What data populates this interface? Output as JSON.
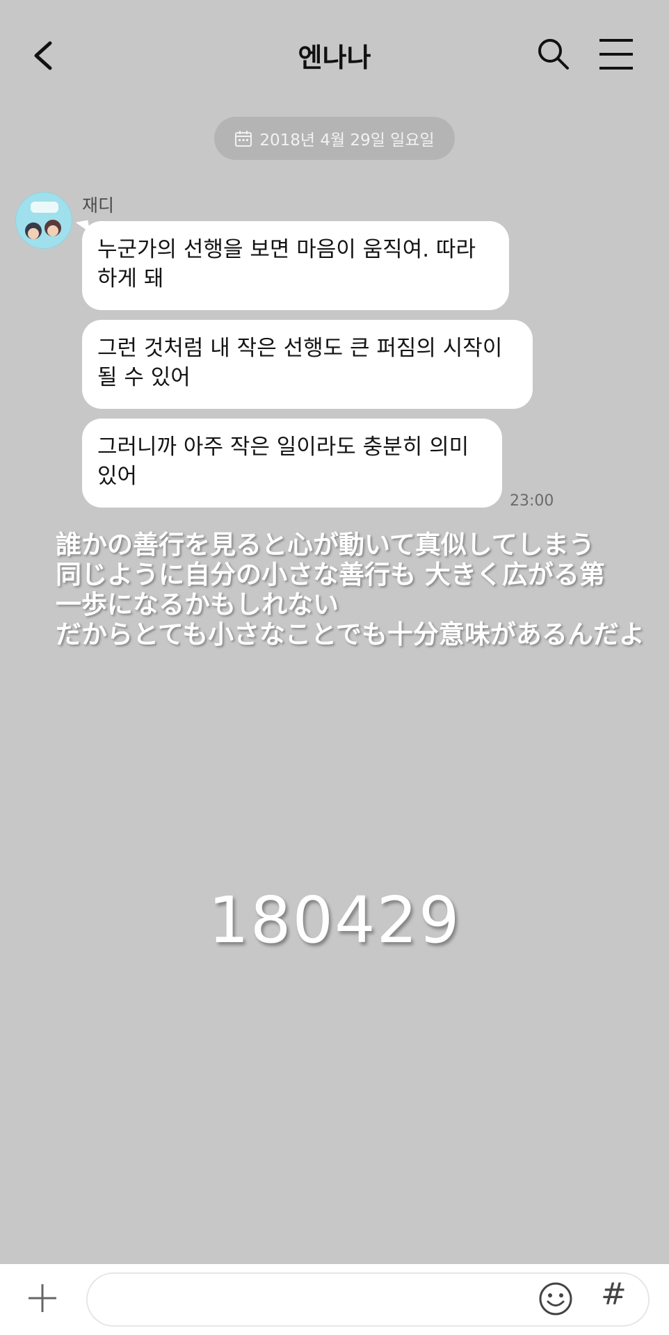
{
  "header": {
    "title": "엔나나"
  },
  "date_divider": "2018년 4월 29일 일요일",
  "message_group": {
    "sender": "재디",
    "messages": [
      "누군가의 선행을 보면 마음이 움직여. 따라\n하게 돼",
      "그런 것처럼 내 작은 선행도 큰 퍼짐의 시작이\n될 수 있어",
      "그러니까 아주 작은 일이라도 충분히 의미\n있어"
    ],
    "time": "23:00"
  },
  "overlay": {
    "japanese_caption": "誰かの善行を見ると心が動いて真似してしまう\n同じように自分の小さな善行も 大きく広がる第\n一歩になるかもしれない\nだからとても小さなことでも十分意味があるんだよ",
    "date_code": "180429"
  },
  "composer": {
    "input_value": "",
    "hash_label": "#"
  },
  "colors": {
    "background": "#c7c7c7",
    "bubble": "#ffffff",
    "pill": "#b4b4b4"
  },
  "icons": [
    "back-arrow-icon",
    "search-icon",
    "menu-icon",
    "calendar-icon",
    "plus-icon",
    "emoji-icon"
  ]
}
